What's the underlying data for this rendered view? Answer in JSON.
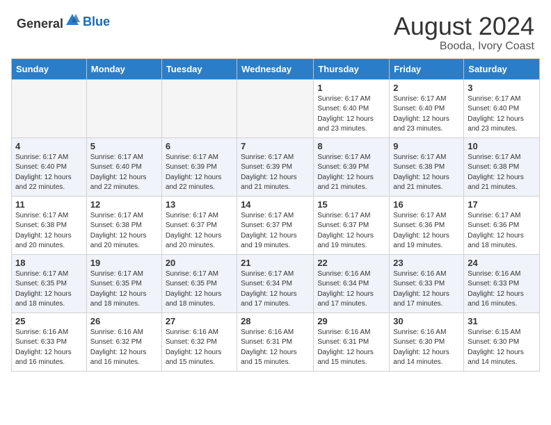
{
  "header": {
    "logo_general": "General",
    "logo_blue": "Blue",
    "month_year": "August 2024",
    "location": "Booda, Ivory Coast"
  },
  "days_of_week": [
    "Sunday",
    "Monday",
    "Tuesday",
    "Wednesday",
    "Thursday",
    "Friday",
    "Saturday"
  ],
  "weeks": [
    [
      {
        "day": "",
        "empty": true
      },
      {
        "day": "",
        "empty": true
      },
      {
        "day": "",
        "empty": true
      },
      {
        "day": "",
        "empty": true
      },
      {
        "day": "1",
        "sunrise": "6:17 AM",
        "sunset": "6:40 PM",
        "daylight": "12 hours and 23 minutes."
      },
      {
        "day": "2",
        "sunrise": "6:17 AM",
        "sunset": "6:40 PM",
        "daylight": "12 hours and 23 minutes."
      },
      {
        "day": "3",
        "sunrise": "6:17 AM",
        "sunset": "6:40 PM",
        "daylight": "12 hours and 23 minutes."
      }
    ],
    [
      {
        "day": "4",
        "sunrise": "6:17 AM",
        "sunset": "6:40 PM",
        "daylight": "12 hours and 22 minutes."
      },
      {
        "day": "5",
        "sunrise": "6:17 AM",
        "sunset": "6:40 PM",
        "daylight": "12 hours and 22 minutes."
      },
      {
        "day": "6",
        "sunrise": "6:17 AM",
        "sunset": "6:39 PM",
        "daylight": "12 hours and 22 minutes."
      },
      {
        "day": "7",
        "sunrise": "6:17 AM",
        "sunset": "6:39 PM",
        "daylight": "12 hours and 21 minutes."
      },
      {
        "day": "8",
        "sunrise": "6:17 AM",
        "sunset": "6:39 PM",
        "daylight": "12 hours and 21 minutes."
      },
      {
        "day": "9",
        "sunrise": "6:17 AM",
        "sunset": "6:38 PM",
        "daylight": "12 hours and 21 minutes."
      },
      {
        "day": "10",
        "sunrise": "6:17 AM",
        "sunset": "6:38 PM",
        "daylight": "12 hours and 21 minutes."
      }
    ],
    [
      {
        "day": "11",
        "sunrise": "6:17 AM",
        "sunset": "6:38 PM",
        "daylight": "12 hours and 20 minutes."
      },
      {
        "day": "12",
        "sunrise": "6:17 AM",
        "sunset": "6:38 PM",
        "daylight": "12 hours and 20 minutes."
      },
      {
        "day": "13",
        "sunrise": "6:17 AM",
        "sunset": "6:37 PM",
        "daylight": "12 hours and 20 minutes."
      },
      {
        "day": "14",
        "sunrise": "6:17 AM",
        "sunset": "6:37 PM",
        "daylight": "12 hours and 19 minutes."
      },
      {
        "day": "15",
        "sunrise": "6:17 AM",
        "sunset": "6:37 PM",
        "daylight": "12 hours and 19 minutes."
      },
      {
        "day": "16",
        "sunrise": "6:17 AM",
        "sunset": "6:36 PM",
        "daylight": "12 hours and 19 minutes."
      },
      {
        "day": "17",
        "sunrise": "6:17 AM",
        "sunset": "6:36 PM",
        "daylight": "12 hours and 18 minutes."
      }
    ],
    [
      {
        "day": "18",
        "sunrise": "6:17 AM",
        "sunset": "6:35 PM",
        "daylight": "12 hours and 18 minutes."
      },
      {
        "day": "19",
        "sunrise": "6:17 AM",
        "sunset": "6:35 PM",
        "daylight": "12 hours and 18 minutes."
      },
      {
        "day": "20",
        "sunrise": "6:17 AM",
        "sunset": "6:35 PM",
        "daylight": "12 hours and 18 minutes."
      },
      {
        "day": "21",
        "sunrise": "6:17 AM",
        "sunset": "6:34 PM",
        "daylight": "12 hours and 17 minutes."
      },
      {
        "day": "22",
        "sunrise": "6:16 AM",
        "sunset": "6:34 PM",
        "daylight": "12 hours and 17 minutes."
      },
      {
        "day": "23",
        "sunrise": "6:16 AM",
        "sunset": "6:33 PM",
        "daylight": "12 hours and 17 minutes."
      },
      {
        "day": "24",
        "sunrise": "6:16 AM",
        "sunset": "6:33 PM",
        "daylight": "12 hours and 16 minutes."
      }
    ],
    [
      {
        "day": "25",
        "sunrise": "6:16 AM",
        "sunset": "6:33 PM",
        "daylight": "12 hours and 16 minutes."
      },
      {
        "day": "26",
        "sunrise": "6:16 AM",
        "sunset": "6:32 PM",
        "daylight": "12 hours and 16 minutes."
      },
      {
        "day": "27",
        "sunrise": "6:16 AM",
        "sunset": "6:32 PM",
        "daylight": "12 hours and 15 minutes."
      },
      {
        "day": "28",
        "sunrise": "6:16 AM",
        "sunset": "6:31 PM",
        "daylight": "12 hours and 15 minutes."
      },
      {
        "day": "29",
        "sunrise": "6:16 AM",
        "sunset": "6:31 PM",
        "daylight": "12 hours and 15 minutes."
      },
      {
        "day": "30",
        "sunrise": "6:16 AM",
        "sunset": "6:30 PM",
        "daylight": "12 hours and 14 minutes."
      },
      {
        "day": "31",
        "sunrise": "6:15 AM",
        "sunset": "6:30 PM",
        "daylight": "12 hours and 14 minutes."
      }
    ]
  ],
  "labels": {
    "sunrise": "Sunrise:",
    "sunset": "Sunset:",
    "daylight": "Daylight:"
  }
}
